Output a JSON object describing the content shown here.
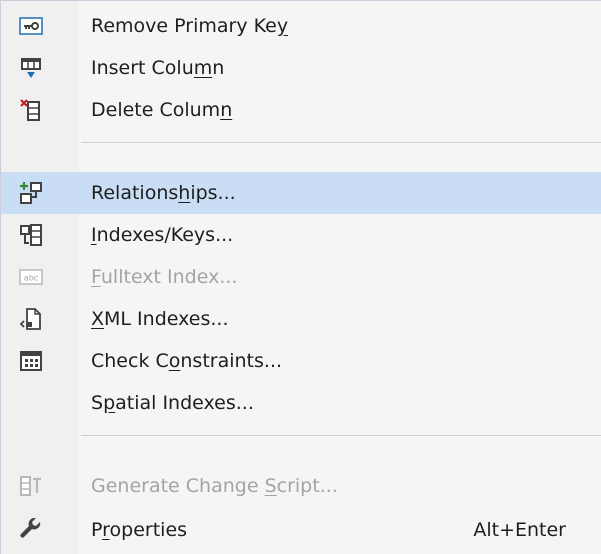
{
  "menu": {
    "items": [
      {
        "pre": "Remove Primary Ke",
        "u": "y",
        "post": "",
        "icon": "primary-key-icon"
      },
      {
        "pre": "Insert Colu",
        "u": "m",
        "post": "n",
        "icon": "insert-column-icon"
      },
      {
        "pre": "Delete Colum",
        "u": "n",
        "post": "",
        "icon": "delete-column-icon"
      },
      {
        "pre": "Relations",
        "u": "h",
        "post": "ips...",
        "icon": "relationships-icon",
        "highlighted": true
      },
      {
        "pre": "",
        "u": "I",
        "post": "ndexes/Keys...",
        "icon": "indexes-keys-icon"
      },
      {
        "pre": "",
        "u": "F",
        "post": "ulltext Index...",
        "icon": "fulltext-index-icon",
        "disabled": true
      },
      {
        "pre": "",
        "u": "X",
        "post": "ML Indexes...",
        "icon": "xml-indexes-icon"
      },
      {
        "pre": "Check C",
        "u": "o",
        "post": "nstraints...",
        "icon": "check-constraints-icon"
      },
      {
        "pre": "S",
        "u": "p",
        "post": "atial Indexes...",
        "icon": ""
      },
      {
        "pre": "Generate Change ",
        "u": "S",
        "post": "cript...",
        "icon": "generate-script-icon",
        "disabled": true
      },
      {
        "pre": "P",
        "u": "r",
        "post": "operties",
        "icon": "wrench-icon",
        "shortcut": "Alt+Enter"
      }
    ]
  },
  "colors": {
    "menu_background": "#f5f5f5",
    "icon_strip": "#f0f0f0",
    "highlight": "#c9def5",
    "text": "#1e1e1e",
    "disabled_text": "#a2a4a5",
    "separator": "#cccedb",
    "icon_blue": "#1f6fb5",
    "icon_dark": "#424242",
    "icon_red": "#c8201f",
    "icon_green": "#388a34"
  }
}
